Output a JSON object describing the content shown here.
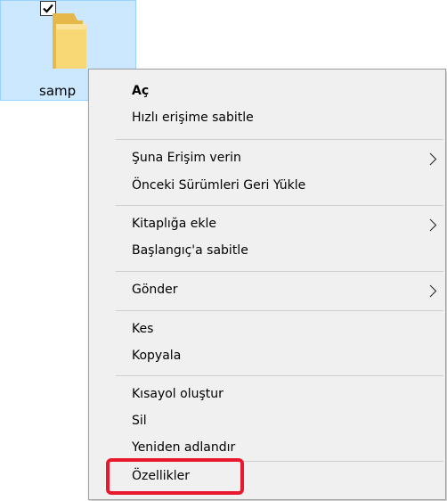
{
  "folder": {
    "label": "samp",
    "checked": true,
    "selected": true
  },
  "context_menu": {
    "items": [
      {
        "label": "Aç",
        "bold": true,
        "has_submenu": false
      },
      {
        "label": "Hızlı erişime sabitle",
        "has_submenu": false
      },
      {
        "label": "Şuna Erişim verin",
        "has_submenu": true
      },
      {
        "label": "Önceki Sürümleri Geri Yükle",
        "has_submenu": false
      },
      {
        "label": "Kitaplığa ekle",
        "has_submenu": true
      },
      {
        "label": "Başlangıç'a sabitle",
        "has_submenu": false
      },
      {
        "label": "Gönder",
        "has_submenu": true
      },
      {
        "label": "Kes",
        "has_submenu": false
      },
      {
        "label": "Kopyala",
        "has_submenu": false
      },
      {
        "label": "Kısayol oluştur",
        "has_submenu": false
      },
      {
        "label": "Sil",
        "has_submenu": false
      },
      {
        "label": "Yeniden adlandır",
        "has_submenu": false
      },
      {
        "label": "Özellikler",
        "has_submenu": false,
        "highlighted": true
      }
    ]
  },
  "colors": {
    "selection_fill": "#cce8ff",
    "selection_border": "#99d1ff",
    "menu_background": "#f0f0f0",
    "highlight": "#e8192c",
    "folder_yellow": "#f8d775"
  },
  "icons": {
    "checkbox": "checkmark-icon",
    "folder": "folder-icon",
    "submenu": "chevron-right-icon"
  }
}
